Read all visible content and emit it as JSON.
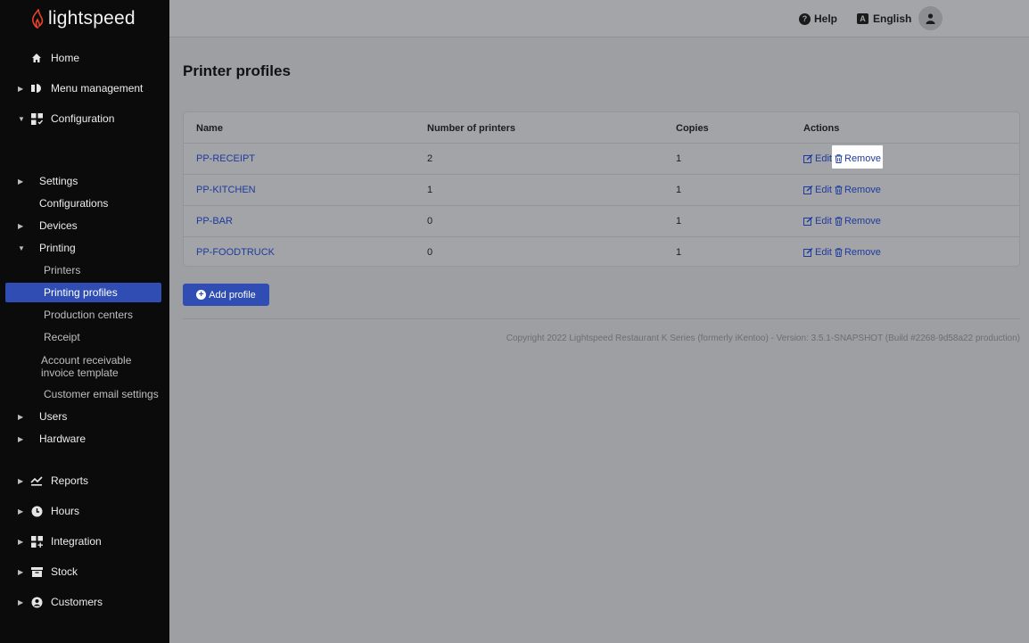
{
  "brand": {
    "name": "lightspeed"
  },
  "topbar": {
    "help_label": "Help",
    "language_label": "English"
  },
  "sidebar": {
    "home": "Home",
    "menu_management": "Menu management",
    "configuration": "Configuration",
    "settings": "Settings",
    "configurations": "Configurations",
    "devices": "Devices",
    "printing": "Printing",
    "printers": "Printers",
    "printing_profiles": "Printing profiles",
    "production_centers": "Production centers",
    "receipt": "Receipt",
    "account_receivable": "Account receivable invoice template",
    "customer_email_settings": "Customer email settings",
    "users": "Users",
    "hardware": "Hardware",
    "reports": "Reports",
    "hours": "Hours",
    "integration": "Integration",
    "stock": "Stock",
    "customers": "Customers"
  },
  "page": {
    "title": "Printer profiles"
  },
  "table": {
    "headers": {
      "name": "Name",
      "printers": "Number of printers",
      "copies": "Copies",
      "actions": "Actions"
    },
    "edit_label": "Edit",
    "remove_label": "Remove",
    "rows": [
      {
        "name": "PP-RECEIPT",
        "printers": "2",
        "copies": "1"
      },
      {
        "name": "PP-KITCHEN",
        "printers": "1",
        "copies": "1"
      },
      {
        "name": "PP-BAR",
        "printers": "0",
        "copies": "1"
      },
      {
        "name": "PP-FOODTRUCK",
        "printers": "0",
        "copies": "1"
      }
    ]
  },
  "buttons": {
    "add_profile": "Add profile"
  },
  "footer": {
    "copyright": "Copyright 2022 Lightspeed Restaurant K Series (formerly iKentoo) - Version: 3.5.1-SNAPSHOT (Build #2268-9d58a22 production)"
  },
  "colors": {
    "accent": "#2f4db3",
    "link": "#1f3a9e",
    "sidebar_bg": "#0b0b0c"
  }
}
